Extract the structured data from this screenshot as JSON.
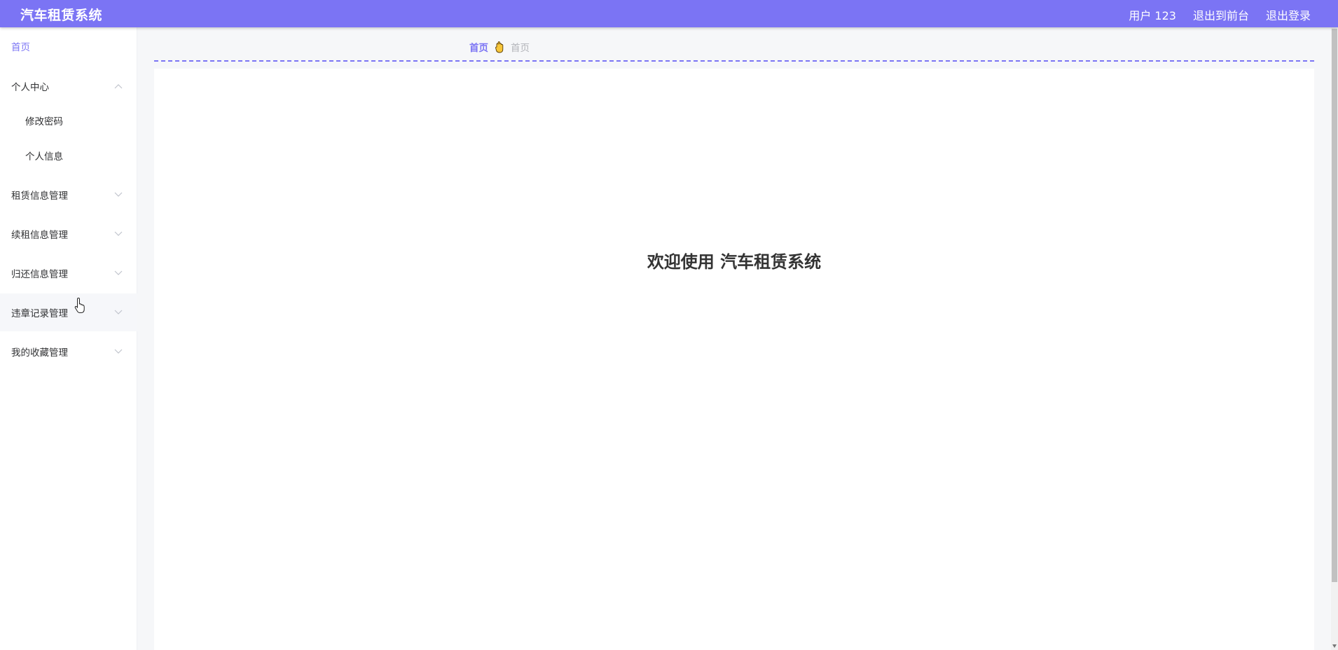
{
  "header": {
    "title": "汽车租赁系统",
    "user_label": "用户 123",
    "to_front_label": "退出到前台",
    "logout_label": "退出登录",
    "bg_color": "#7b74f4"
  },
  "sidebar": {
    "home_label": "首页",
    "personal_center": {
      "label": "个人中心",
      "expanded": true,
      "children": [
        "修改密码",
        "个人信息"
      ]
    },
    "groups": [
      "租赁信息管理",
      "续租信息管理",
      "归还信息管理",
      "违章记录管理",
      "我的收藏管理"
    ]
  },
  "breadcrumb": {
    "home": "首页",
    "current": "首页",
    "icon": "hand-icon"
  },
  "main": {
    "welcome": "欢迎使用 汽车租赁系统"
  },
  "colors": {
    "accent": "#7b74f4",
    "content_bg": "#f6f7f9"
  }
}
